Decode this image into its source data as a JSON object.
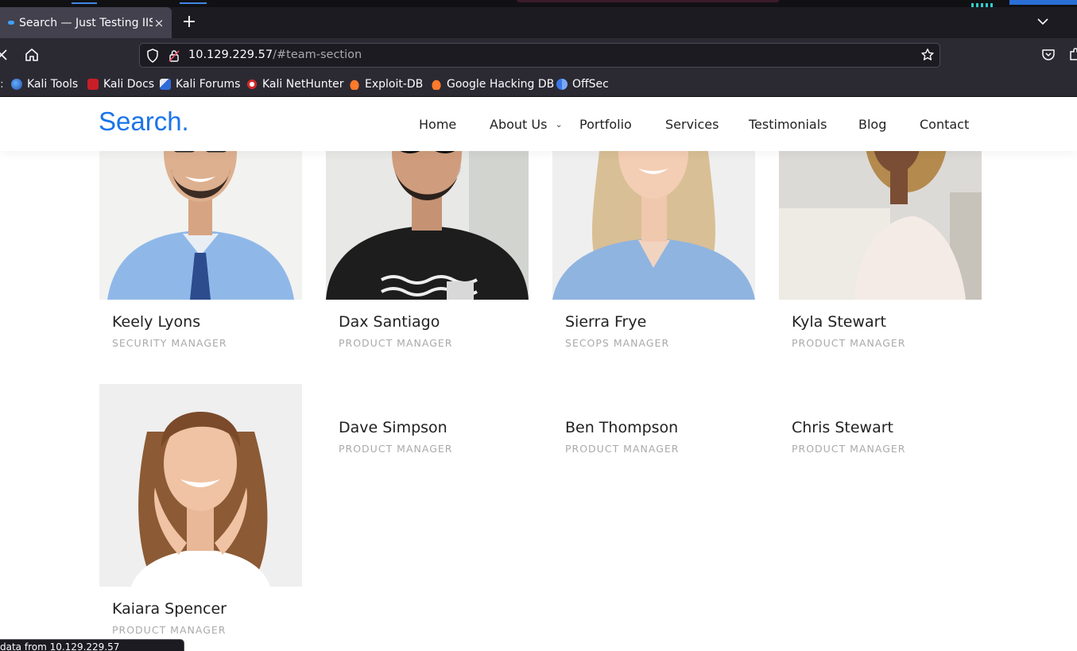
{
  "browser": {
    "tab_title": "Search — Just Testing IIS",
    "tab_close": "×",
    "new_tab": "+",
    "url_host": "10.129.229.57",
    "url_path": "/#team-section",
    "bookmarks": [
      "Kali Tools",
      "Kali Docs",
      "Kali Forums",
      "Kali NetHunter",
      "Exploit-DB",
      "Google Hacking DB",
      "OffSec"
    ],
    "status_text": "data from 10.129.229.57"
  },
  "site": {
    "logo": "Search.",
    "menu": [
      "Home",
      "About Us",
      "Portfolio",
      "Services",
      "Testimonials",
      "Blog",
      "Contact"
    ],
    "accent_color": "#1a74e8"
  },
  "team": [
    {
      "name": "Keely Lyons",
      "role": "SECURITY MANAGER"
    },
    {
      "name": "Dax Santiago",
      "role": "PRODUCT MANAGER"
    },
    {
      "name": "Sierra Frye",
      "role": "SECOPS MANAGER"
    },
    {
      "name": "Kyla Stewart",
      "role": "PRODUCT MANAGER"
    },
    {
      "name": "Kaiara Spencer",
      "role": "PRODUCT MANAGER"
    },
    {
      "name": "Dave Simpson",
      "role": "PRODUCT MANAGER"
    },
    {
      "name": "Ben Thompson",
      "role": "PRODUCT MANAGER"
    },
    {
      "name": "Chris Stewart",
      "role": "PRODUCT MANAGER"
    }
  ]
}
